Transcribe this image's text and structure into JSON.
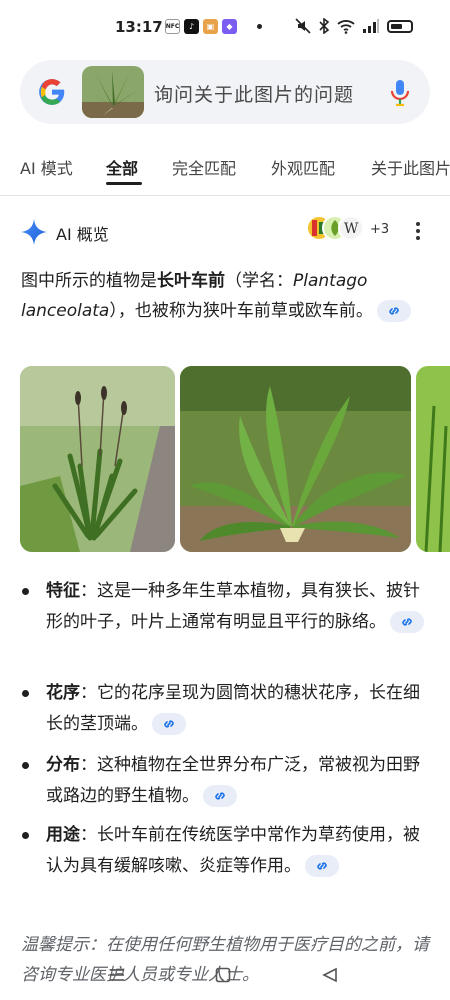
{
  "status_bar": {
    "time": "13:17",
    "app_icons": [
      "NFC",
      "TT",
      "box",
      "pink-app"
    ],
    "battery": "battery-icon"
  },
  "search": {
    "placeholder": "询问关于此图片的问题",
    "logo": "google-logo",
    "mic": "microphone-icon"
  },
  "tabs": [
    {
      "label": "AI 模式"
    },
    {
      "label": "全部"
    },
    {
      "label": "完全匹配"
    },
    {
      "label": "外观匹配"
    },
    {
      "label": "关于此图片"
    }
  ],
  "ai_overview": {
    "title": "AI 概览",
    "more_sources": "+3",
    "intro": {
      "part1": "图中所示的植物是",
      "bold": "长叶车前",
      "part2": "（学名：",
      "latin": "Plantago lanceolata",
      "part3": "），也被称为狭叶车前草或欧车前。"
    },
    "bullets": [
      {
        "term": "特征",
        "text": "：这是一种多年生草本植物，具有狭长、披针形的叶子，叶片上通常有明显且平行的脉络。"
      },
      {
        "term": "花序",
        "text": "：它的花序呈现为圆筒状的穗状花序，长在细长的茎顶端。"
      },
      {
        "term": "分布",
        "text": "：这种植物在全世界分布广泛，常被视为田野或路边的野生植物。"
      },
      {
        "term": "用途",
        "text": "：长叶车前在传统医学中常作为草药使用，被认为具有缓解咳嗽、炎症等作用。"
      }
    ],
    "footnote": "温馨提示：在使用任何野生植物用于医疗目的之前，请咨询专业医护人员或专业人士。"
  },
  "colors": {
    "accent_blue": "#1a73e8",
    "search_bg": "#f1f3f6",
    "chip_bg": "#e8edf7"
  }
}
